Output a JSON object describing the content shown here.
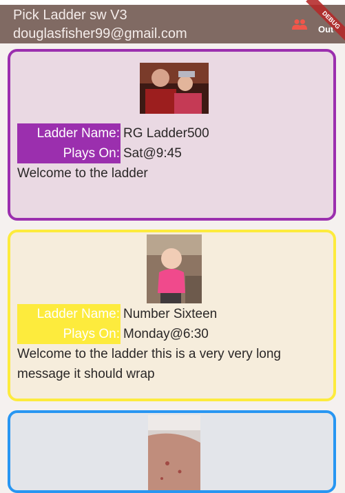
{
  "appbar": {
    "title": "Pick Ladder sw V3",
    "subtitle": "douglasfisher99@gmail.com",
    "logout_label": "Out",
    "debug_banner": "DEBUG",
    "icon_color": "#f0564a"
  },
  "ladders": [
    {
      "ladder_name_label": "Ladder Name:",
      "ladder_name": "RG Ladder500",
      "plays_on_label": "Plays On:",
      "plays_on": "Sat@9:45",
      "message": "Welcome to the ladder",
      "color": "#9b2fae"
    },
    {
      "ladder_name_label": "Ladder Name:",
      "ladder_name": "Number Sixteen",
      "plays_on_label": "Plays On:",
      "plays_on": "Monday@6:30",
      "message": "Welcome to the ladder this is a very very long message it should wrap",
      "color": "#fdeb3d"
    },
    {
      "color": "#2896f2"
    }
  ]
}
